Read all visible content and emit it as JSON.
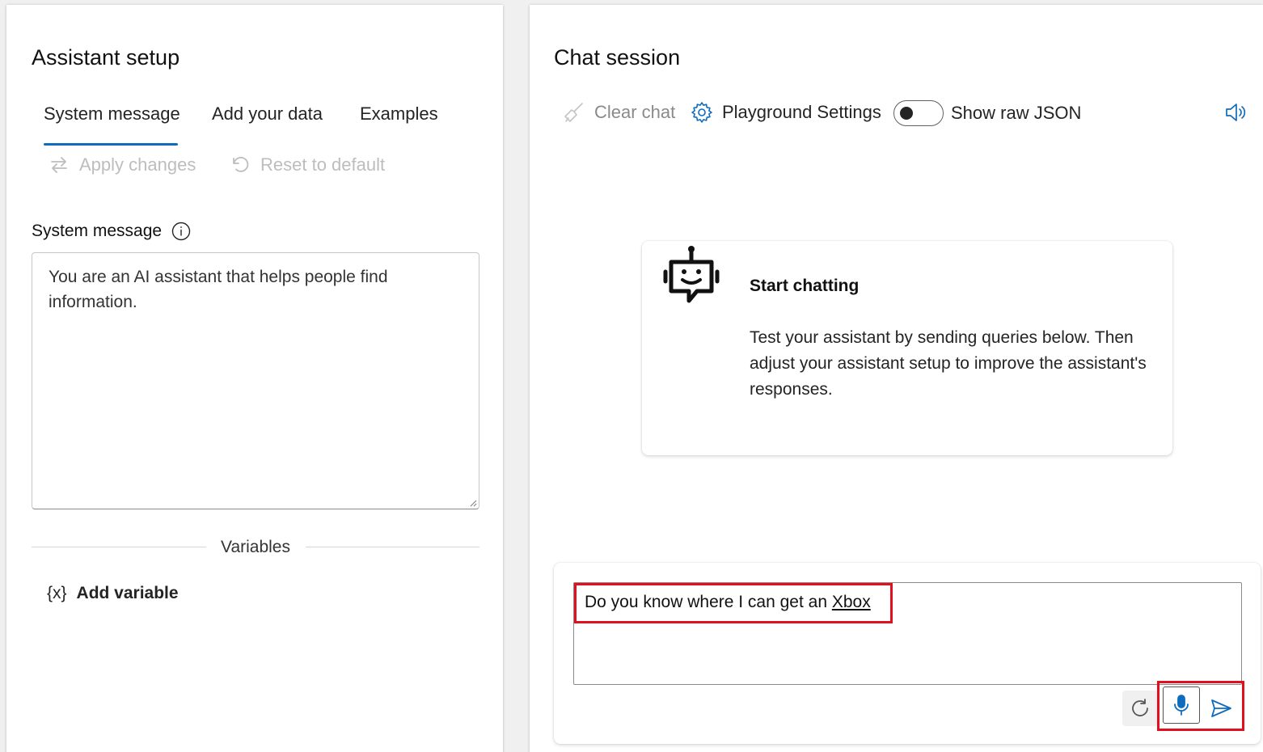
{
  "assistant_setup": {
    "title": "Assistant setup",
    "tabs": [
      {
        "label": "System message",
        "active": true
      },
      {
        "label": "Add your data",
        "active": false
      },
      {
        "label": "Examples",
        "active": false
      }
    ],
    "apply_changes_label": "Apply changes",
    "reset_label": "Reset to default",
    "system_message_label": "System message",
    "system_message_value": "You are an AI assistant that helps people find information.",
    "variables_label": "Variables",
    "add_variable_label": "Add variable",
    "add_variable_icon_text": "{x}"
  },
  "chat_session": {
    "title": "Chat session",
    "clear_chat_label": "Clear chat",
    "playground_settings_label": "Playground Settings",
    "show_raw_json_label": "Show raw JSON",
    "show_raw_json_on": false,
    "start_card": {
      "title": "Start chatting",
      "body": "Test your assistant by sending queries below. Then adjust your assistant setup to improve the assistant's responses."
    },
    "input": {
      "text_prefix": "Do you know where I can get an ",
      "text_underlined": "Xbox"
    }
  },
  "colors": {
    "accent": "#0f6cbd",
    "highlight": "#e0101e",
    "disabled": "#bdbdbd"
  },
  "icons": [
    "swap-arrows-icon",
    "undo-icon",
    "info-icon",
    "variable-icon",
    "broom-icon",
    "gear-icon",
    "speaker-icon",
    "robot-icon",
    "refresh-icon",
    "microphone-icon",
    "send-icon"
  ]
}
